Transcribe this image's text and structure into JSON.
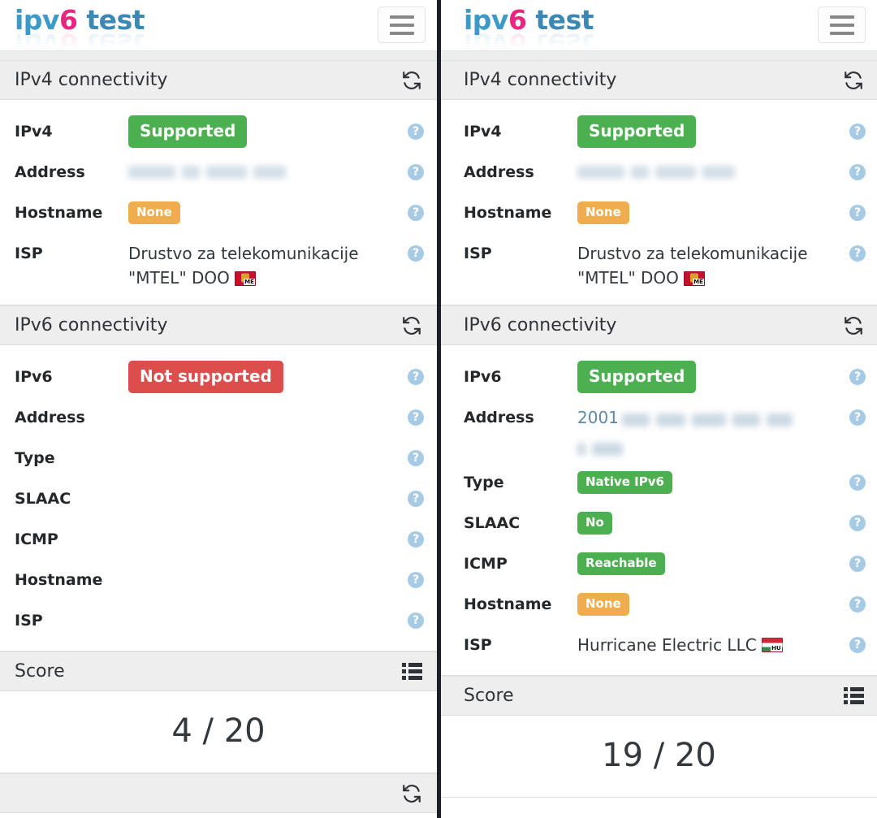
{
  "brand": {
    "logo_part1": "ipv",
    "logo_digit": "6",
    "logo_part2": " test",
    "menu_icon": "hamburger-icon"
  },
  "icons": {
    "refresh": "refresh-icon",
    "list": "list-icon",
    "help": "?"
  },
  "left_panel": {
    "ipv4": {
      "title": "IPv4 connectivity",
      "rows": [
        {
          "label": "IPv4",
          "badge": "Supported",
          "badge_color": "#4cb050",
          "badge_type": "green-big"
        },
        {
          "label": "Address",
          "value_redacted": true
        },
        {
          "label": "Hostname",
          "badge": "None",
          "badge_color": "#efad4d",
          "badge_type": "orange-small"
        },
        {
          "label": "ISP",
          "value": "Drustvo za telekomunikacije \"MTEL\" DOO",
          "flag": "ME"
        }
      ]
    },
    "ipv6": {
      "title": "IPv6 connectivity",
      "rows": [
        {
          "label": "IPv6",
          "badge": "Not supported",
          "badge_color": "#db4e4c",
          "badge_type": "red-big"
        },
        {
          "label": "Address",
          "value": ""
        },
        {
          "label": "Type",
          "value": ""
        },
        {
          "label": "SLAAC",
          "value": ""
        },
        {
          "label": "ICMP",
          "value": ""
        },
        {
          "label": "Hostname",
          "value": ""
        },
        {
          "label": "ISP",
          "value": ""
        }
      ]
    },
    "score": {
      "title": "Score",
      "value": "4 / 20"
    }
  },
  "right_panel": {
    "ipv4": {
      "title": "IPv4 connectivity",
      "rows": [
        {
          "label": "IPv4",
          "badge": "Supported",
          "badge_color": "#4cb050",
          "badge_type": "green-big"
        },
        {
          "label": "Address",
          "value_redacted": true
        },
        {
          "label": "Hostname",
          "badge": "None",
          "badge_color": "#efad4d",
          "badge_type": "orange-small"
        },
        {
          "label": "ISP",
          "value": "Drustvo za telekomunikacije \"MTEL\" DOO",
          "flag": "ME"
        }
      ]
    },
    "ipv6": {
      "title": "IPv6 connectivity",
      "rows": [
        {
          "label": "IPv6",
          "badge": "Supported",
          "badge_color": "#4cb050",
          "badge_type": "green-big"
        },
        {
          "label": "Address",
          "value_prefix": "2001",
          "value_redacted": true
        },
        {
          "label": "Type",
          "badge": "Native IPv6",
          "badge_color": "#4cb050",
          "badge_type": "green-small"
        },
        {
          "label": "SLAAC",
          "badge": "No",
          "badge_color": "#4cb050",
          "badge_type": "green-small"
        },
        {
          "label": "ICMP",
          "badge": "Reachable",
          "badge_color": "#4cb050",
          "badge_type": "green-small"
        },
        {
          "label": "Hostname",
          "badge": "None",
          "badge_color": "#efad4d",
          "badge_type": "orange-small"
        },
        {
          "label": "ISP",
          "value": "Hurricane Electric LLC",
          "flag": "HU"
        }
      ]
    },
    "score": {
      "title": "Score",
      "value": "19 / 20"
    }
  }
}
